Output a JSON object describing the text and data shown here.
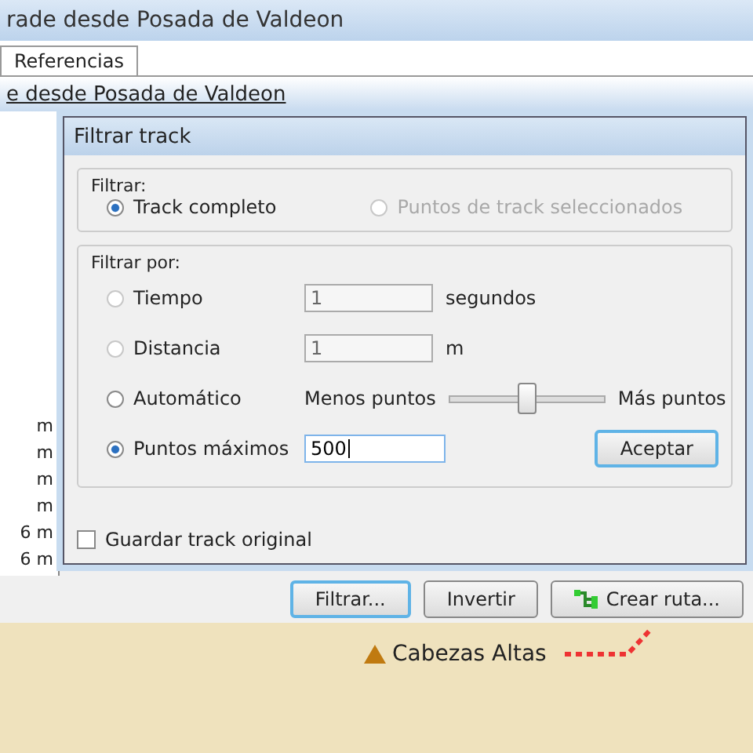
{
  "background_window": {
    "title": "rade desde Posada de Valdeon",
    "tabs": [
      {
        "label": "Referencias"
      }
    ],
    "track_name": "e desde Posada de Valdeon",
    "distance_column": [
      "m",
      "m",
      "m",
      "m",
      "6 m",
      "6 m"
    ],
    "buttons": [
      {
        "label": "Filtrar...",
        "kind": "plain",
        "focused": true
      },
      {
        "label": "Invertir",
        "kind": "plain",
        "focused": false
      },
      {
        "label": "Crear ruta...",
        "kind": "icon",
        "focused": false
      }
    ]
  },
  "map": {
    "place_label": "Cabezas Altas"
  },
  "dialog": {
    "title": "Filtrar track",
    "filter_label": "Filtrar:",
    "scope": [
      {
        "label": "Track completo",
        "selected": true,
        "disabled": false
      },
      {
        "label": "Puntos de track seleccionados",
        "selected": false,
        "disabled": true
      }
    ],
    "filter_by_label": "Filtrar por:",
    "methods": [
      {
        "kind": "field",
        "label": "Tiempo",
        "selected": false,
        "value": "1",
        "unit": "segundos",
        "disabled": true
      },
      {
        "kind": "field",
        "label": "Distancia",
        "selected": false,
        "value": "1",
        "unit": "m",
        "disabled": true
      },
      {
        "kind": "slider",
        "label": "Automático",
        "selected": false,
        "min_label": "Menos puntos",
        "max_label": "Más puntos",
        "level": 0.5
      },
      {
        "kind": "field",
        "label": "Puntos máximos",
        "selected": true,
        "value": "500",
        "disabled": false
      }
    ],
    "accept_button": "Aceptar",
    "save_original": {
      "label": "Guardar track original",
      "checked": false
    }
  }
}
